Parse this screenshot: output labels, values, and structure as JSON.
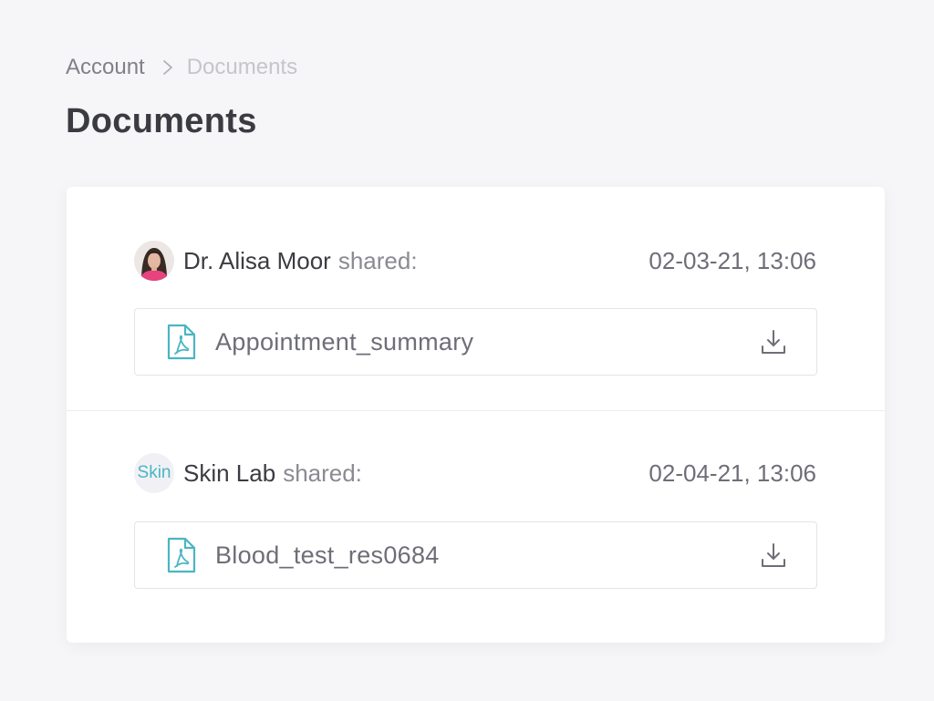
{
  "breadcrumb": {
    "parent": "Account",
    "current": "Documents"
  },
  "page": {
    "title": "Documents"
  },
  "shares": [
    {
      "sharer": "Dr. Alisa Moor",
      "shared_label": "shared:",
      "date": "02-03-21, 13:06",
      "avatar": "person-photo",
      "file": {
        "name": "Appointment_summary",
        "icon": "pdf-file-icon"
      }
    },
    {
      "sharer": "Skin Lab",
      "shared_label": "shared:",
      "date": "02-04-21, 13:06",
      "avatar_text": "Skin",
      "file": {
        "name": "Blood_test_res0684",
        "icon": "pdf-file-icon"
      }
    }
  ],
  "colors": {
    "background": "#f6f6f8",
    "card": "#ffffff",
    "accent": "#4ab5c4",
    "title": "#3b3b42",
    "muted": "#808088"
  },
  "icons": {
    "breadcrumb_separator": "chevron-right-icon",
    "download": "download-icon"
  }
}
